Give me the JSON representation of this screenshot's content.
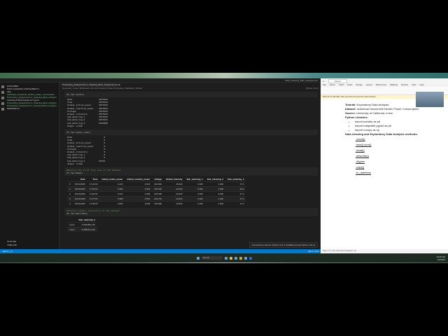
{
  "vscode": {
    "title": "Data_Cleaning_EDA_Assignment1",
    "explorer_header": "EXPLORER",
    "folder": "DATA CLEANING ASSIGNMENT 1",
    "files": [
      "data",
      "Individual_household_electric_power_consumption",
      "Processing_Assignment1.1_Cleaning_EDA_Assignment.html",
      "Cleaning & EDA Assignment.ipynb",
      "Processing_Assignment1.1_Cleaning_EDA_Assignment.ipynb",
      "Processing_Assignment1.1_Cleaning_EDA_Assignment.pdf",
      "README.md"
    ],
    "outline": "OUTLINE",
    "timeline": "TIMELINE",
    "tab": "Processing_Assignment1.1_Cleaning_EDA_Assignment.ipynb",
    "toolbar": [
      "Generate",
      "Code",
      "Markdown",
      "Run All",
      "Restart",
      "Clear All Outputs",
      "Variables",
      "Outline"
    ],
    "kernel": "Python 3.11.4",
    "cell1": {
      "code": "df_raw.count()",
      "output": "Date                     2075259\nTime                     2075259\nGlobal_active_power      2075259\nGlobal_reactive_power    2075259\nVoltage                  2075259\nGlobal_intensity         2075259\nSub_metering_1           2075259\nSub_metering_2           2075259\nSub_metering_3           2049280\ndtype: int64"
    },
    "cell2": {
      "code": "df_raw.isna().sum()",
      "output": "Date                         0\nTime                         0\nGlobal_active_power          0\nGlobal_reactive_power        0\nVoltage                      0\nGlobal_intensity             0\nSub_metering_1               0\nSub_metering_2               0\nSub_metering_3           25979\ndtype: int64"
    },
    "cell3": {
      "comment": "#Display the first five rows of the dataset",
      "code": "df_raw.head()"
    },
    "head_table": {
      "columns": [
        "",
        "Date",
        "Time",
        "Global_active_power",
        "Global_reactive_power",
        "Voltage",
        "Global_intensity",
        "Sub_metering_1",
        "Sub_metering_2",
        "Sub_metering_3"
      ],
      "rows": [
        [
          "0",
          "16/12/2006",
          "17:24:00",
          "4.216",
          "0.418",
          "234.840",
          "18.400",
          "0.000",
          "1.000",
          "17.0"
        ],
        [
          "1",
          "16/12/2006",
          "17:25:00",
          "5.360",
          "0.436",
          "233.630",
          "23.000",
          "0.000",
          "1.000",
          "16.0"
        ],
        [
          "2",
          "16/12/2006",
          "17:26:00",
          "5.374",
          "0.498",
          "233.290",
          "23.000",
          "0.000",
          "2.000",
          "17.0"
        ],
        [
          "3",
          "16/12/2006",
          "17:27:00",
          "5.388",
          "0.502",
          "233.740",
          "23.000",
          "0.000",
          "1.000",
          "17.0"
        ],
        [
          "4",
          "16/12/2006",
          "17:28:00",
          "3.666",
          "0.528",
          "235.680",
          "15.800",
          "0.000",
          "1.000",
          "17.0"
        ]
      ]
    },
    "cell4": {
      "comment": "#Display summary statistics of the dataset",
      "code": "df_raw.describe()"
    },
    "describe_table": {
      "columns": [
        "",
        "Sub_metering_3"
      ],
      "rows": [
        [
          "count",
          "2.049280e+06"
        ],
        [
          "mean",
          "6.458447e+00"
        ]
      ]
    },
    "status_left": "main  0 △ 0",
    "status_right": "Cell 1 of 34",
    "notification": "Connecting to kernel: Python 3.11.4 (Installing kernel Python 3.11.4)"
  },
  "word": {
    "search": "Search",
    "menu": [
      "File",
      "Home",
      "Insert",
      "Draw",
      "Design",
      "Layout",
      "References",
      "Mailings",
      "Review",
      "View",
      "Help"
    ],
    "warning": "SIGN IN TO UPLOAD: Save and share this document with OneDrive",
    "tutorial_label": "Tutorial:",
    "tutorial": "Exploratory Data Analysis",
    "dataset_label": "Dataset:",
    "dataset": "Individual Household Electric Power Consumption",
    "source_label": "Source:",
    "source": "University of California, Irvine",
    "libs_label": "Python Libraries:",
    "libs": [
      "import pandas as pd",
      "import matplotlib.pyplot as plt",
      "import numpy as np"
    ],
    "methods_label": "Data cleaning and Exploratory Data Analysis methods:",
    "methods": [
      ".count()",
      ".isna().sum()",
      ".head()",
      ".describe()",
      ".dtypes",
      ".copy()",
      ".to_datetime"
    ],
    "status": "Page 1 of 1   121 words   Text Predictions: On"
  },
  "taskbar": {
    "search": "Search",
    "time": "10:25 AM",
    "date": "1/2/2024"
  }
}
